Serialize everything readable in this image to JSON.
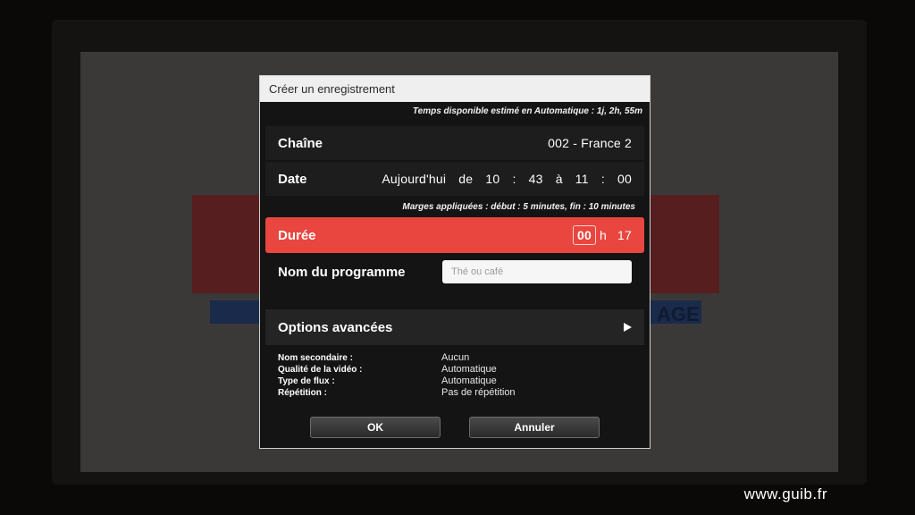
{
  "dialog": {
    "title": "Créer un enregistrement",
    "available_time": "Temps disponible estimé en Automatique : 1j, 2h, 55m",
    "channel": {
      "label": "Chaîne",
      "value": "002 - France 2"
    },
    "date": {
      "label": "Date",
      "day": "Aujourd'hui",
      "from_word": "de",
      "start_hour": "10",
      "sep1": ":",
      "start_min": "43",
      "to_word": "à",
      "end_hour": "11",
      "sep2": ":",
      "end_min": "00"
    },
    "margins": "Marges appliquées : début : 5 minutes, fin : 10 minutes",
    "duration": {
      "label": "Durée",
      "hours": "00",
      "h_unit": "h",
      "minutes": "17"
    },
    "program_name": {
      "label": "Nom du programme",
      "placeholder": "Thé ou café"
    },
    "advanced_options": {
      "label": "Options avancées",
      "icon": "play-arrow-icon"
    },
    "details": [
      {
        "label": "Nom secondaire :",
        "value": "Aucun"
      },
      {
        "label": "Qualité de la vidéo :",
        "value": "Automatique"
      },
      {
        "label": "Type de flux :",
        "value": "Automatique"
      },
      {
        "label": "Répétition :",
        "value": "Pas de répétition"
      }
    ],
    "buttons": {
      "ok": "OK",
      "cancel": "Annuler"
    }
  },
  "background": {
    "logo_tag": "AGE"
  },
  "watermark": "www.guib.fr",
  "colors": {
    "highlight": "#e8463f",
    "dialog_bg": "#141414",
    "title_bg": "#efefef"
  }
}
